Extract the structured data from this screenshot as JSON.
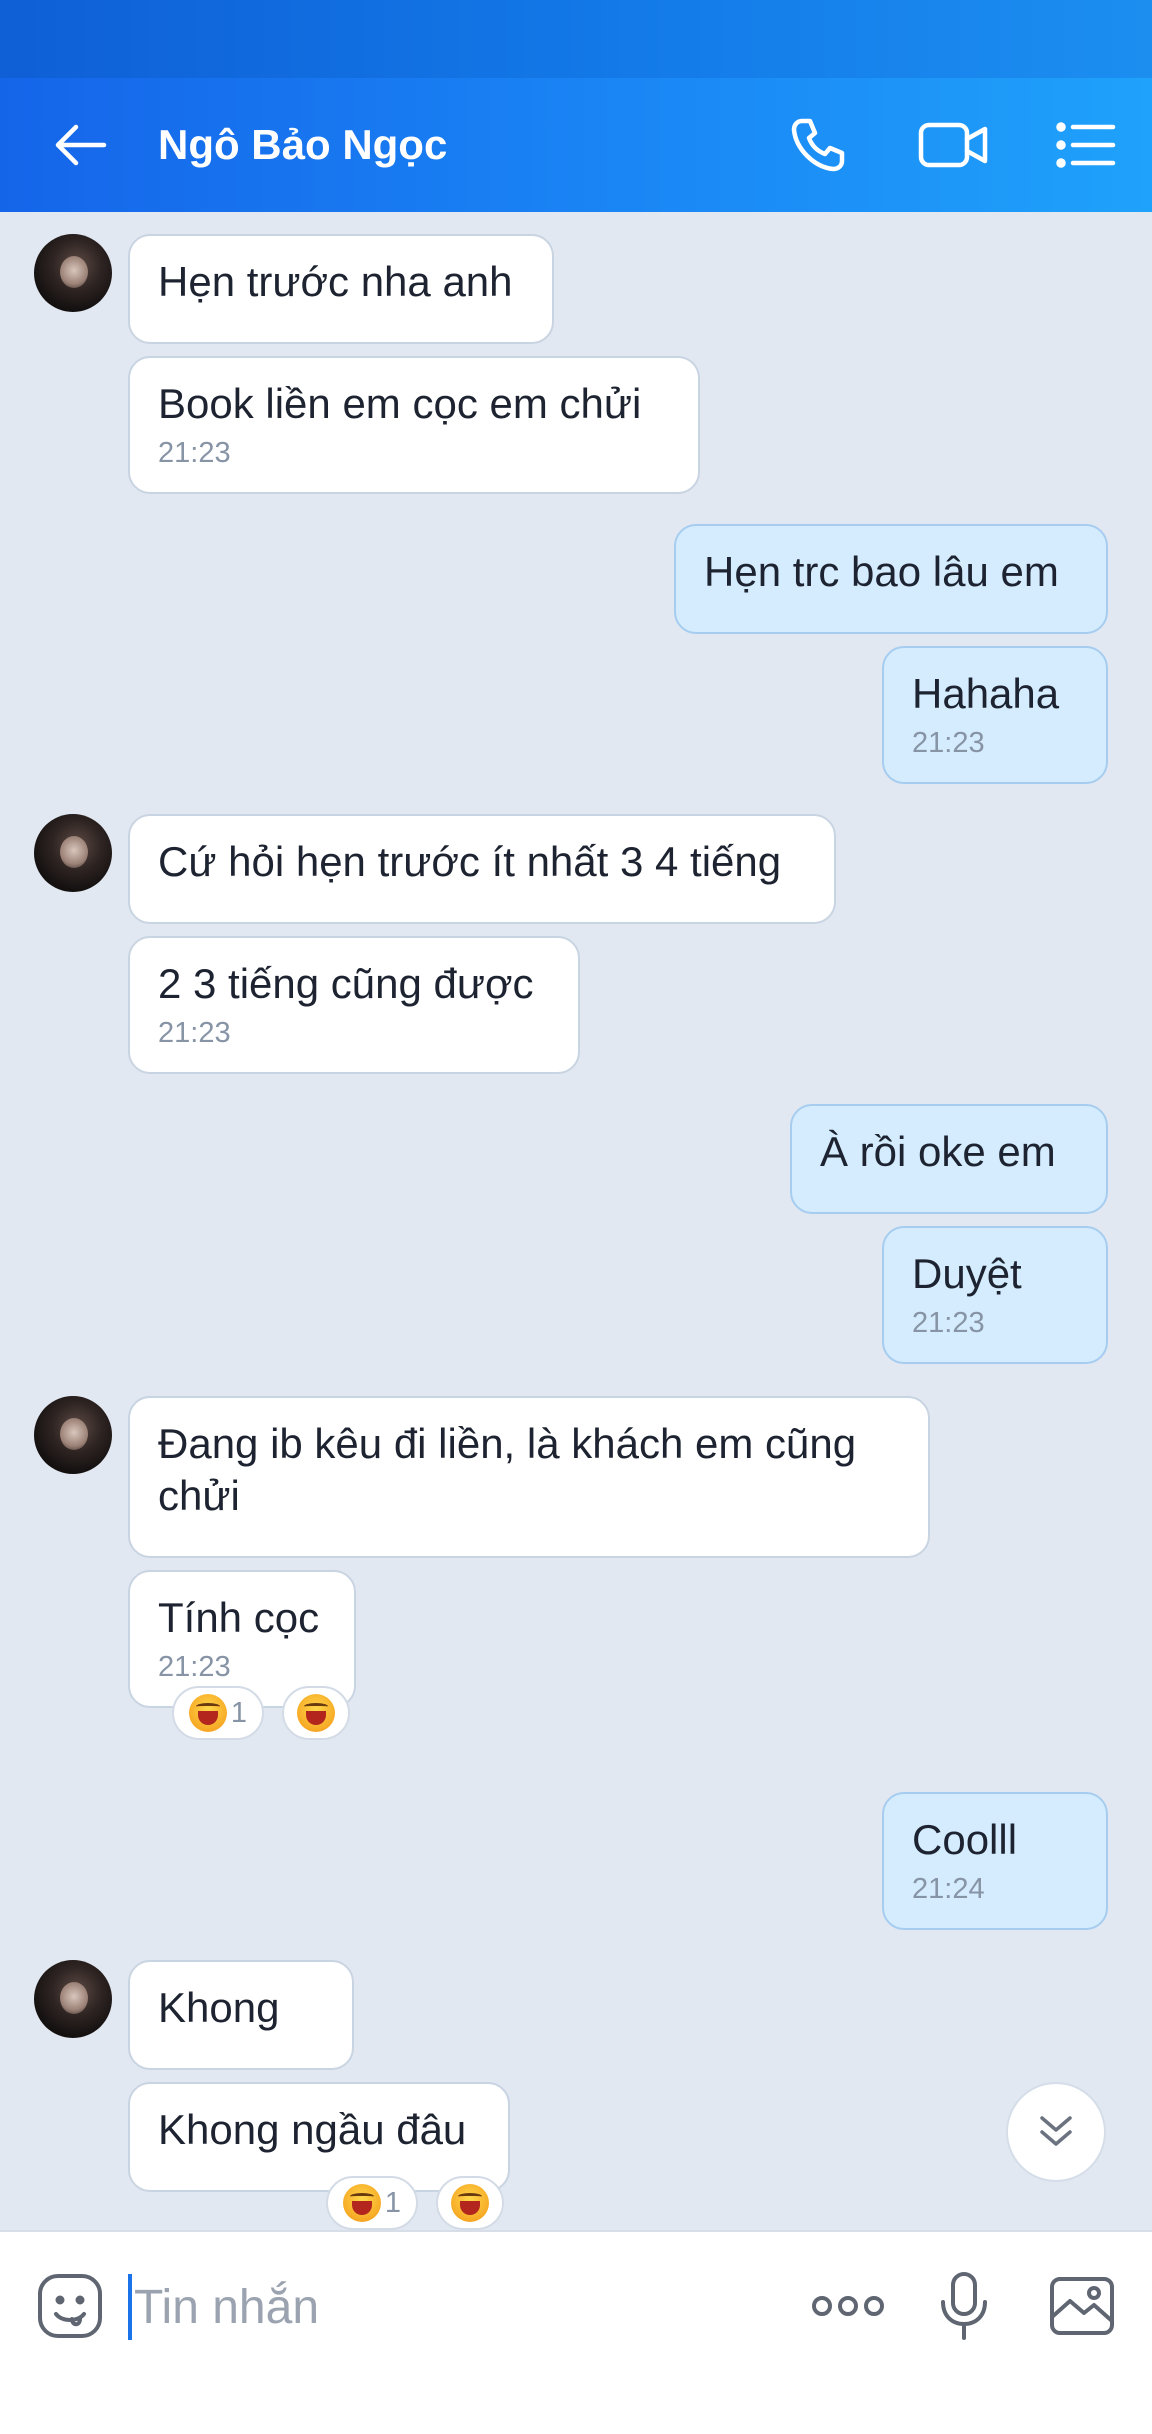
{
  "header": {
    "contact_name": "Ngô Bảo Ngọc"
  },
  "messages": [
    {
      "side": "in",
      "text": "Hẹn trước nha anh"
    },
    {
      "side": "in",
      "text": "Book liền em cọc em chửi",
      "time": "21:23"
    },
    {
      "side": "out",
      "text": "Hẹn trc bao lâu em"
    },
    {
      "side": "out",
      "text": "Hahaha",
      "time": "21:23"
    },
    {
      "side": "in",
      "text": "Cứ hỏi hẹn trước ít nhất 3 4 tiếng"
    },
    {
      "side": "in",
      "text": "2 3 tiếng cũng được",
      "time": "21:23"
    },
    {
      "side": "out",
      "text": "À rồi oke em"
    },
    {
      "side": "out",
      "text": "Duyệt",
      "time": "21:23"
    },
    {
      "side": "in",
      "text": "Đang ib kêu đi liền, là khách em cũng chửi"
    },
    {
      "side": "in",
      "text": "Tính cọc",
      "time": "21:23",
      "reaction_count": "1"
    },
    {
      "side": "out",
      "text": "Coolll",
      "time": "21:24"
    },
    {
      "side": "in",
      "text": "Khong"
    },
    {
      "side": "in",
      "text": "Khong ngầu đâu",
      "reaction_count": "1"
    }
  ],
  "composer": {
    "placeholder": "Tin nhắn"
  },
  "icons": {
    "back": "arrow-left-icon",
    "call": "phone-icon",
    "video": "video-camera-icon",
    "menu": "list-menu-icon",
    "sticker": "sticker-face-icon",
    "more": "more-dots-icon",
    "mic": "microphone-icon",
    "image": "image-gallery-icon",
    "scroll": "double-chevron-down-icon",
    "reaction": "laughing-face-emoji"
  },
  "colors": {
    "header_blue": "#1a86f5",
    "outgoing_bubble": "#d4ecfd",
    "incoming_bubble": "#ffffff",
    "chat_background": "#e2e8f1"
  }
}
